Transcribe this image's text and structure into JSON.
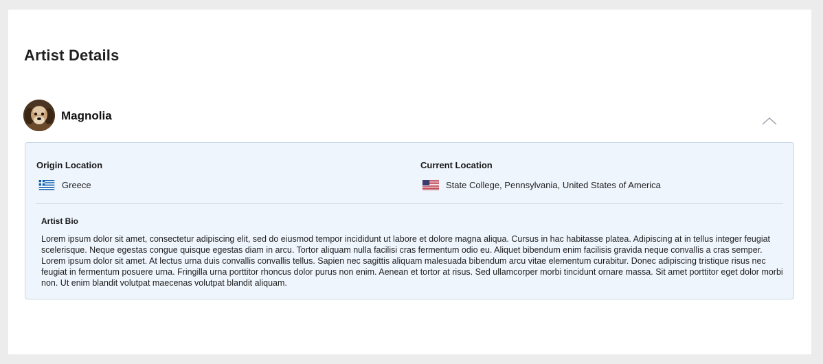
{
  "page": {
    "title": "Artist Details"
  },
  "artist": {
    "name": "Magnolia",
    "avatar_icon": "dog-photo-avatar"
  },
  "details": {
    "origin": {
      "label": "Origin Location",
      "value": "Greece",
      "flag": "greece-flag-icon"
    },
    "current": {
      "label": "Current Location",
      "value": "State College, Pennsylvania, United States of America",
      "flag": "usa-flag-icon"
    },
    "bio": {
      "label": "Artist Bio",
      "text": "Lorem ipsum dolor sit amet, consectetur adipiscing elit, sed do eiusmod tempor incididunt ut labore et dolore magna aliqua. Cursus in hac habitasse platea. Adipiscing at in tellus integer feugiat scelerisque. Neque egestas congue quisque egestas diam in arcu. Tortor aliquam nulla facilisi cras fermentum odio eu. Aliquet bibendum enim facilisis gravida neque convallis a cras semper. Lorem ipsum dolor sit amet. At lectus urna duis convallis convallis tellus. Sapien nec sagittis aliquam malesuada bibendum arcu vitae elementum curabitur. Donec adipiscing tristique risus nec feugiat in fermentum posuere urna. Fringilla urna porttitor rhoncus dolor purus non enim. Aenean et tortor at risus. Sed ullamcorper morbi tincidunt ornare massa. Sit amet porttitor eget dolor morbi non. Ut enim blandit volutpat maecenas volutpat blandit aliquam."
    }
  },
  "colors": {
    "panel_background": "#eff5fd",
    "panel_border": "#c9d6e6",
    "page_background": "#ececec"
  }
}
